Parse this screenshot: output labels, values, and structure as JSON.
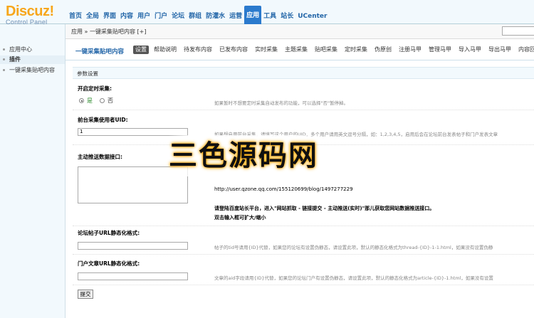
{
  "logo": {
    "main": "Discuz!",
    "sub": "Control Panel"
  },
  "topnav": [
    "首页",
    "全局",
    "界面",
    "内容",
    "用户",
    "门户",
    "论坛",
    "群组",
    "防灌水",
    "运营",
    "应用",
    "工具",
    "站长",
    "UCenter"
  ],
  "topnav_active_index": 10,
  "breadcrumb": "应用 » 一键采集贴吧内容 [+]",
  "sidebar": [
    {
      "label": "应用中心",
      "active": false
    },
    {
      "label": "插件",
      "active": true
    },
    {
      "label": "一键采集贴吧内容",
      "active": false
    }
  ],
  "subnav": {
    "title": "一键采集贴吧内容",
    "tabs": [
      "设置",
      "帮助说明",
      "待发布内容",
      "已发布内容",
      "实时采集",
      "主题采集",
      "贴吧采集",
      "定时采集",
      "伪原创",
      "注册马甲",
      "管理马甲",
      "导入马甲",
      "导出马甲",
      "内容回收站"
    ]
  },
  "section_title": "参数设置",
  "fields": {
    "schedule": {
      "label": "开启定时采集:",
      "yes": "是",
      "no": "否",
      "tip": "如果暂时不想要定时采集自动发布的功能，可以选择\"否\"暂停掉。"
    },
    "uid": {
      "label": "前台采集使用者UID:",
      "value": "1",
      "tip": "如果想启用前台采集，请填写这个用户的UID，多个用户请用英文逗号分隔，如：1,2,3,4,5，启用后会在论坛前台发表帖子和门户发表文章"
    },
    "push": {
      "label": "主动推送数据接口:",
      "url": "http://user.qzone.qq.com/155120699/blog/1497277229",
      "note1": "请登陆百度站长平台，进入\"网站抓取 - 链接提交 - 主动推送(实时)\"那儿获取您网站数据推送接口。",
      "note2": "双击输入框可扩大/缩小"
    },
    "forum_url": {
      "label": "论坛帖子URL静态化格式:",
      "tip": "帖子的tid号请用{ID}代替，如果您的论坛有设置伪静态，请设置此项，默认的静态化格式为thread-{ID}-1-1.html，如果没有设置伪静"
    },
    "portal_url": {
      "label": "门户文章URL静态化格式:",
      "tip": "文章的aid字段请用{ID}代替，如果您的论坛门户有设置伪静态，请设置此项，默认的静态化格式为article-{ID}-1.html，如果没有设置"
    }
  },
  "submit_label": "提交",
  "watermark": "三色源码网"
}
